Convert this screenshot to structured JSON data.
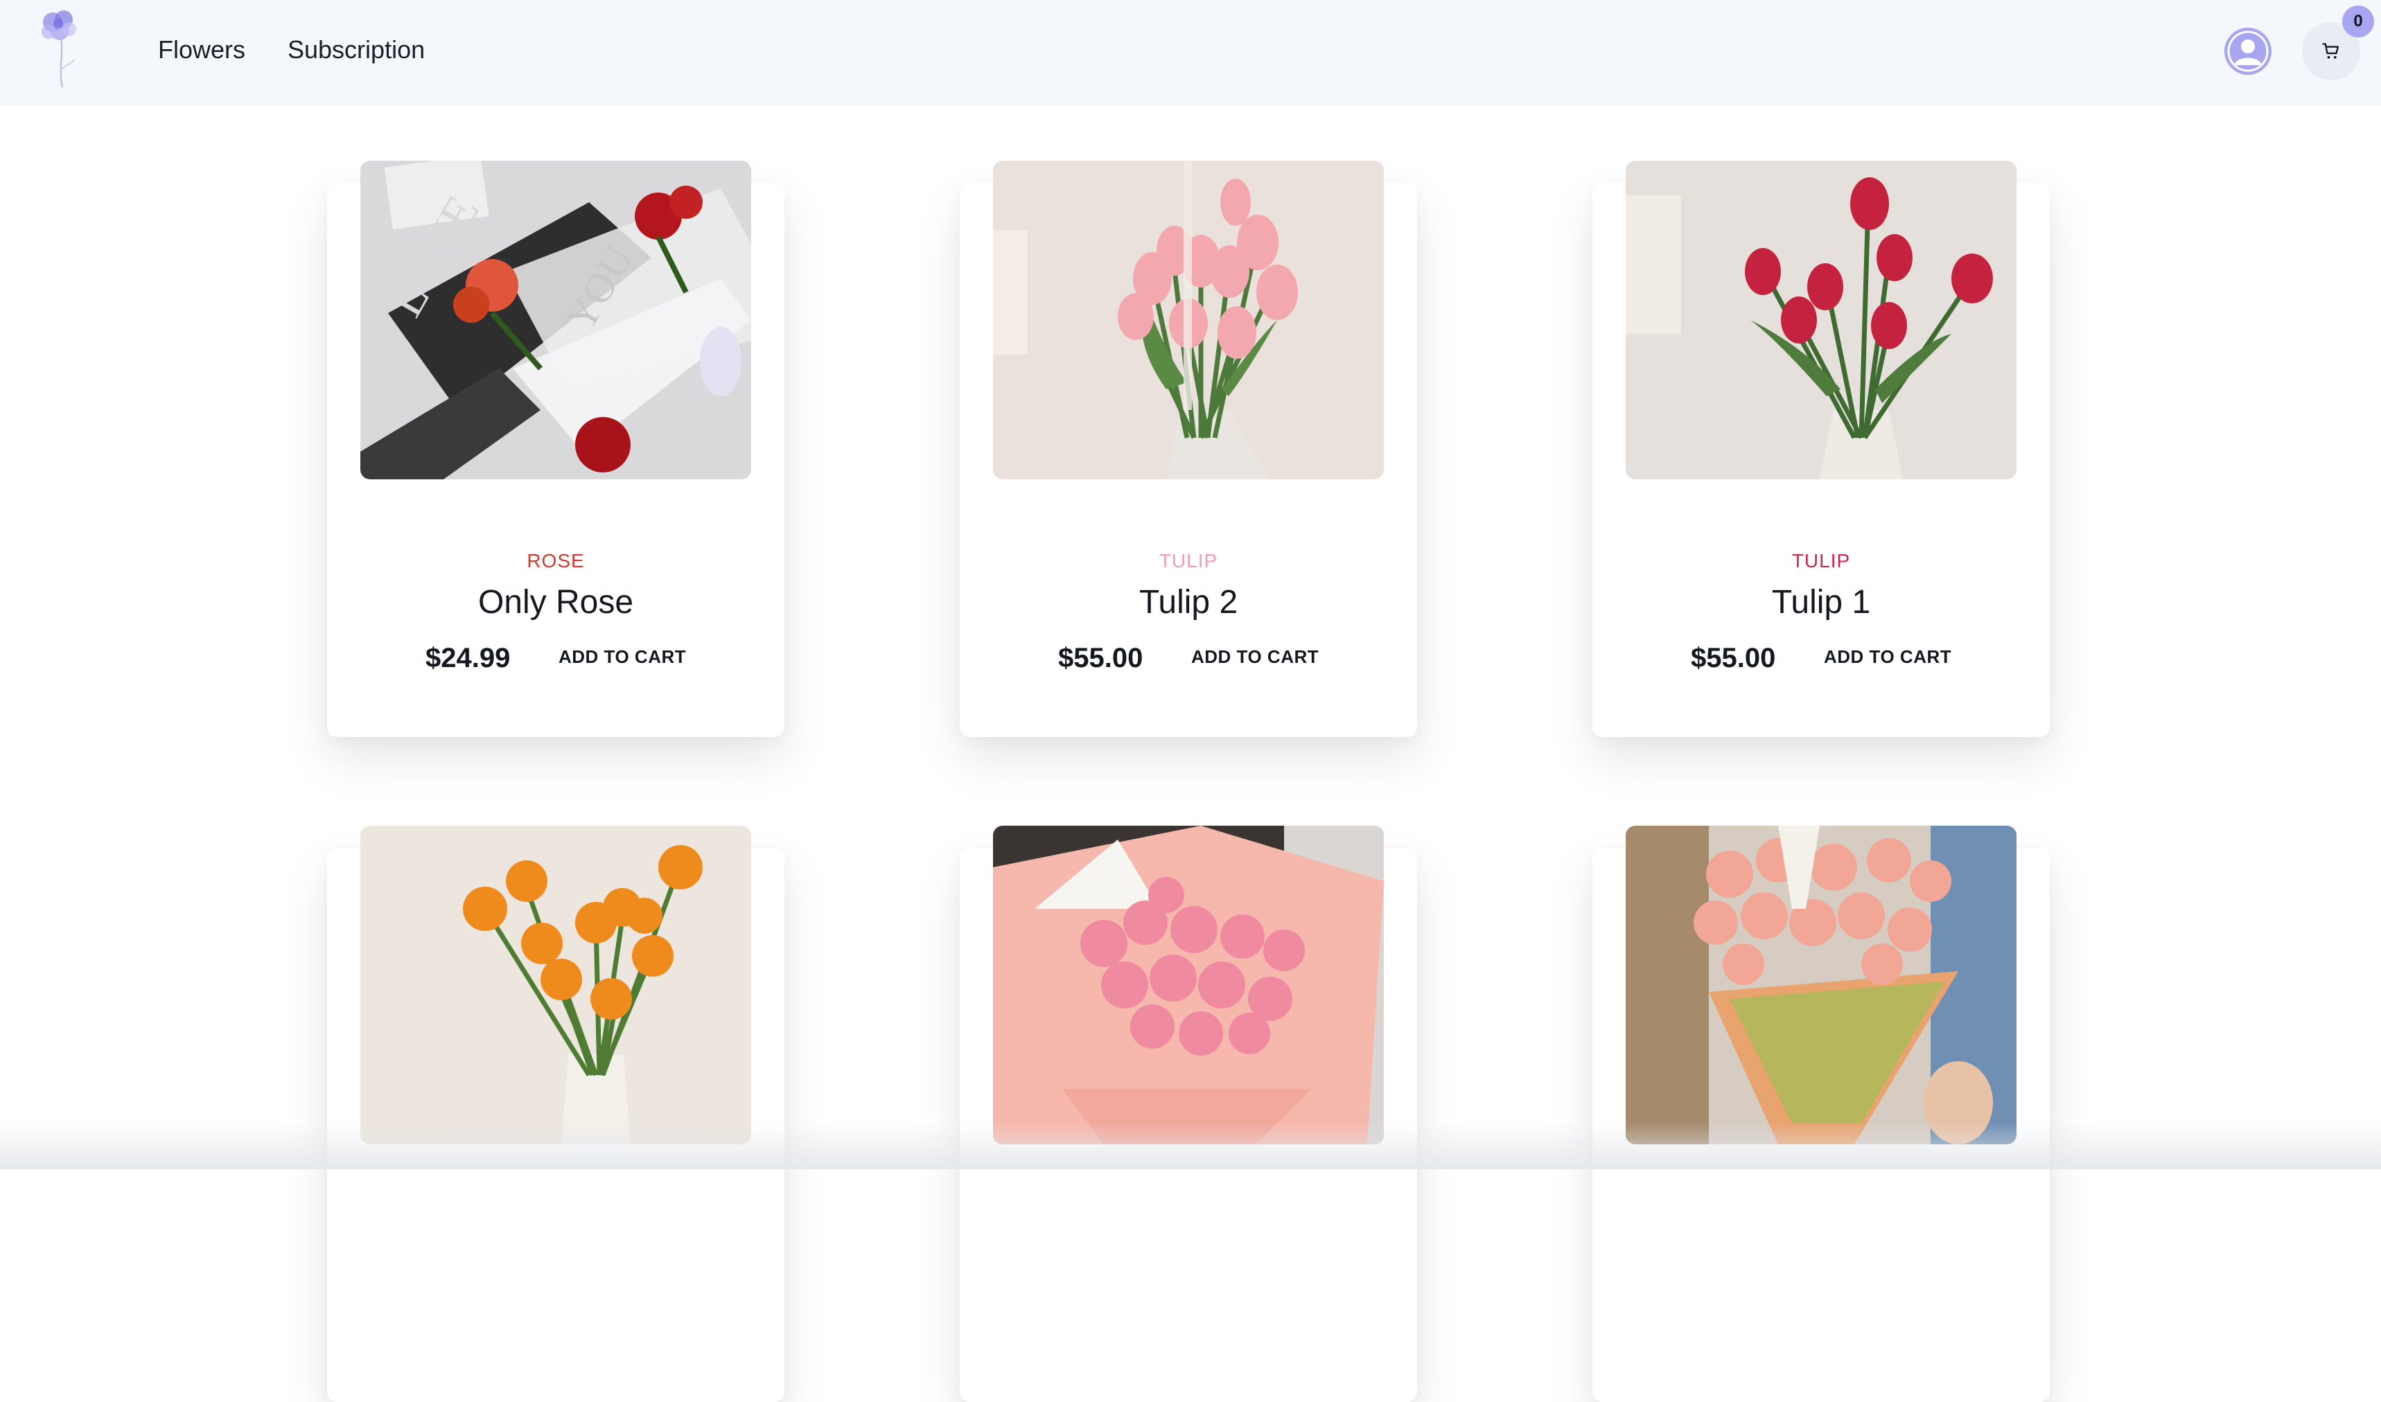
{
  "header": {
    "logo_icon": "flower-logo-icon",
    "nav": [
      {
        "label": "Flowers"
      },
      {
        "label": "Subscription"
      }
    ],
    "account_icon": "user-avatar-icon",
    "cart_icon": "shopping-cart-icon",
    "cart_count": "0"
  },
  "colors": {
    "header_bg": "#f4f7fb",
    "accent": "#a9a6f1",
    "rose_category": "#d2382c",
    "tulip_light_category": "#f39bb5",
    "tulip_category": "#d0254a"
  },
  "products": [
    {
      "category": "ROSE",
      "name": "Only Rose",
      "price": "$24.99",
      "button": "ADD TO CART",
      "image": "wrapped red roses in printed paper"
    },
    {
      "category": "TULIP",
      "name": "Tulip 2",
      "price": "$55.00",
      "button": "ADD TO CART",
      "image": "pink tulips in a paper bag"
    },
    {
      "category": "TULIP",
      "name": "Tulip 1",
      "price": "$55.00",
      "button": "ADD TO CART",
      "image": "red tulips in a paper bag"
    },
    {
      "image": "orange ranunculus bouquet"
    },
    {
      "image": "pink carnation bouquet"
    },
    {
      "image": "peach roses in a cone wrap"
    }
  ]
}
